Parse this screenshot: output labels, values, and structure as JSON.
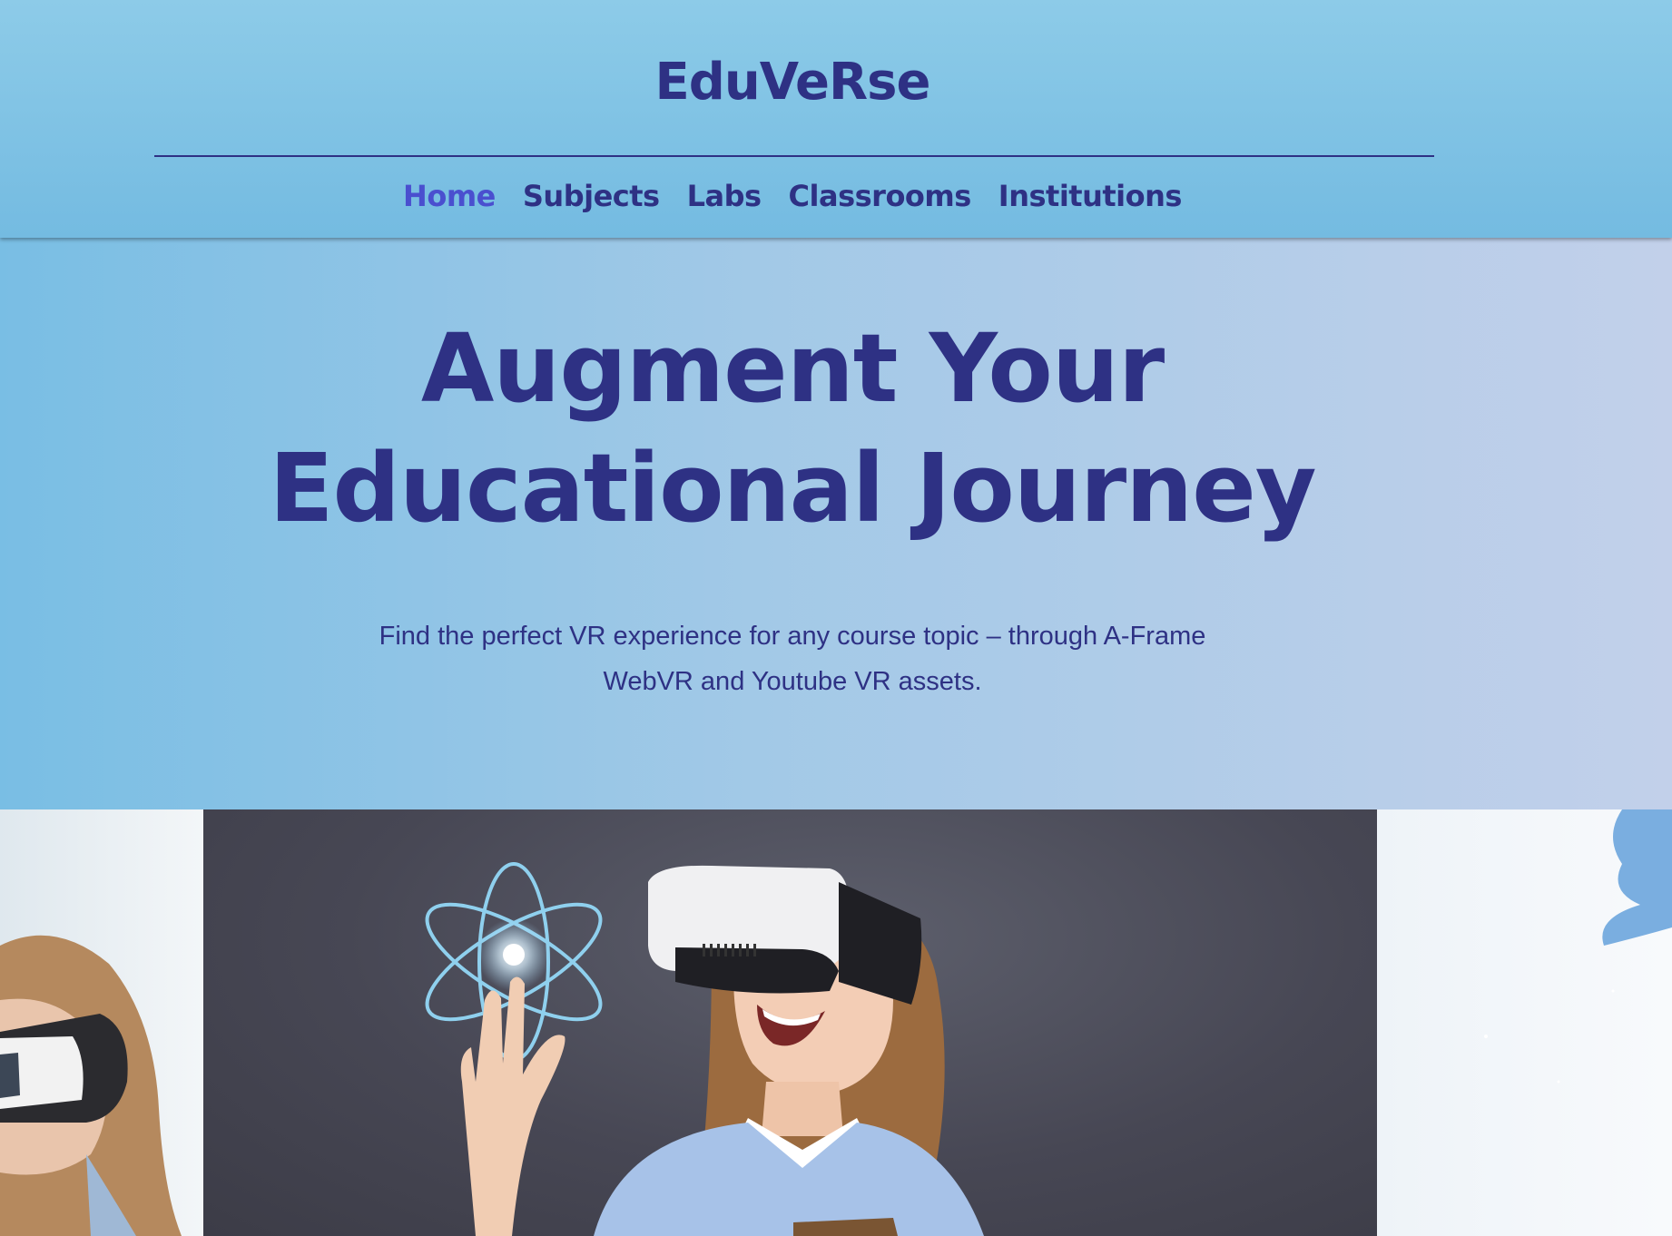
{
  "header": {
    "logo": "EduVeRse",
    "nav": [
      {
        "label": "Home",
        "active": true
      },
      {
        "label": "Subjects",
        "active": false
      },
      {
        "label": "Labs",
        "active": false
      },
      {
        "label": "Classrooms",
        "active": false
      },
      {
        "label": "Institutions",
        "active": false
      }
    ]
  },
  "hero": {
    "title_line1": "Augment Your",
    "title_line2": "Educational Journey",
    "subtitle_line1": "Find the perfect VR experience for any course topic – through A-Frame",
    "subtitle_line2": "WebVR and Youtube VR assets."
  },
  "gallery": {
    "images": [
      {
        "name": "girl-vr-headset-left"
      },
      {
        "name": "student-vr-atom"
      },
      {
        "name": "hand-hologram-right"
      }
    ]
  },
  "colors": {
    "brand": "#2e3184",
    "active_nav": "#4a4fcf",
    "header_bg": "#7dc2e5"
  }
}
